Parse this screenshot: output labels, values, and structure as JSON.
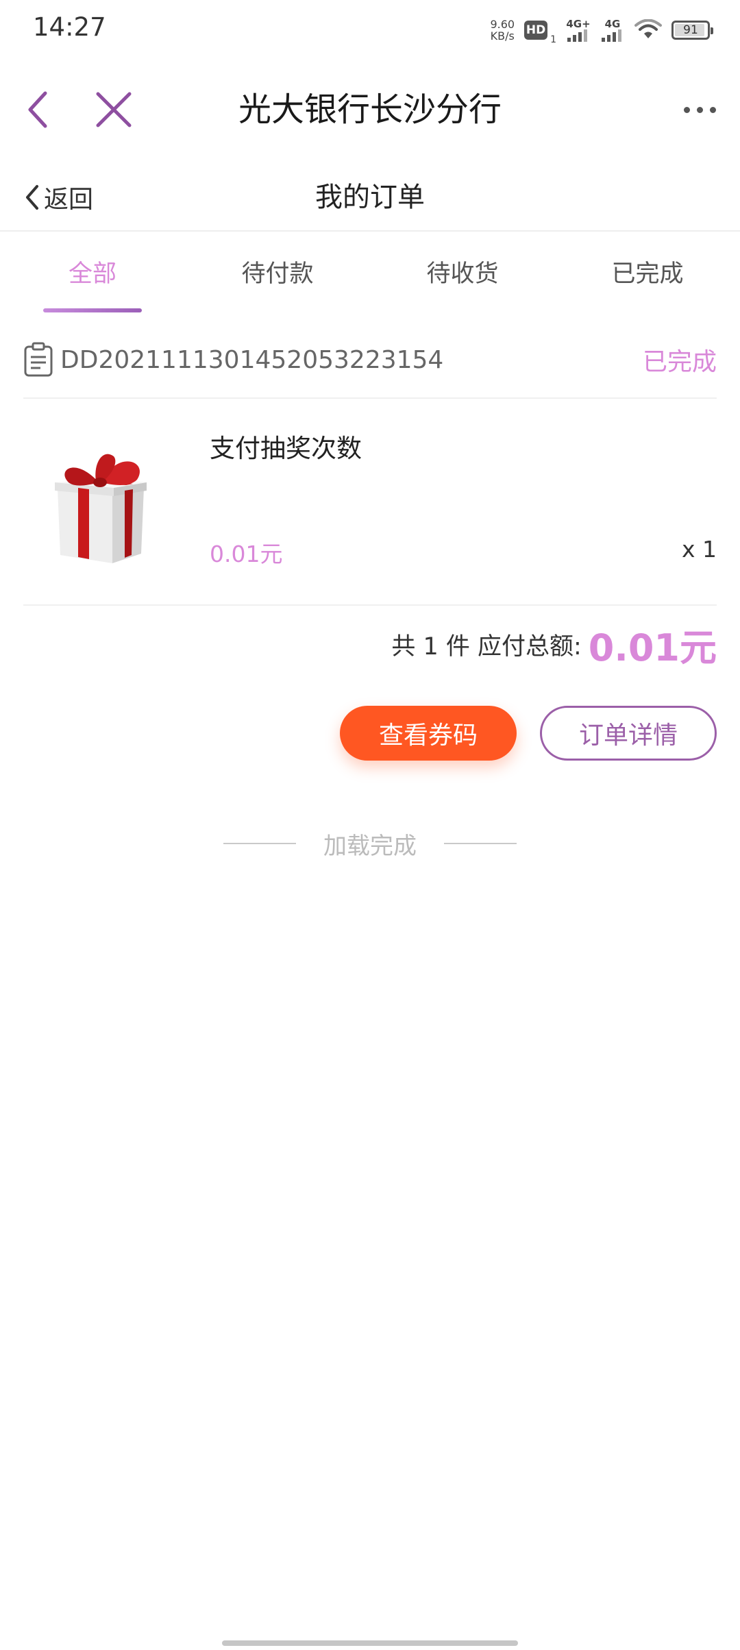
{
  "status_bar": {
    "time": "14:27",
    "net_speed_value": "9.60",
    "net_speed_unit": "KB/s",
    "hd_label": "HD",
    "hd_sub": "1",
    "signal_1_label": "4G+",
    "signal_2_label": "4G",
    "battery_level": "91"
  },
  "nav": {
    "title": "光大银行长沙分行"
  },
  "page": {
    "back_label": "返回",
    "title": "我的订单"
  },
  "tabs": [
    {
      "label": "全部",
      "active": true
    },
    {
      "label": "待付款",
      "active": false
    },
    {
      "label": "待收货",
      "active": false
    },
    {
      "label": "已完成",
      "active": false
    }
  ],
  "order": {
    "number": "DD20211113014520532231​54",
    "status": "已完成",
    "product_name": "支付抽奖次数",
    "price": "0.01元",
    "quantity": "x 1",
    "summary_prefix": "共 1 件  应付总额:",
    "total": "0.01元",
    "btn_coupon": "查看券码",
    "btn_detail": "订单详情"
  },
  "footer": {
    "load_text": "加载完成"
  },
  "colors": {
    "accent": "#d988d9",
    "brand_purple": "#9b5fa8",
    "button_orange": "#ff5722"
  }
}
